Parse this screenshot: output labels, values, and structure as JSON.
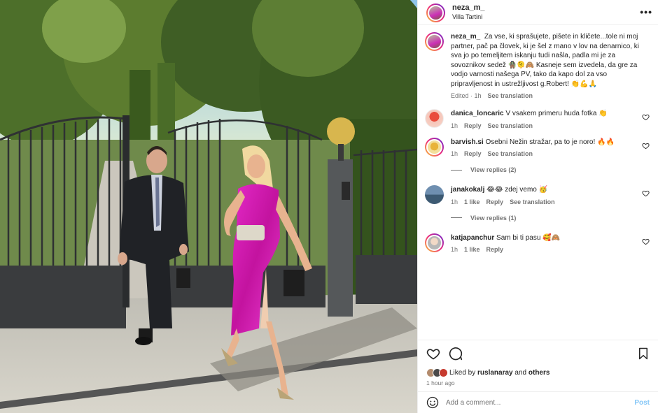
{
  "post": {
    "username": "neza_m_",
    "location": "Villa Tartini",
    "caption_user": "neza_m_",
    "caption_text": "Za vse, ki sprašujete, pišete in kličete...tole ni moj partner, pač pa človek, ki je šel z mano v lov na denarnico, ki sva jo po temeljitem iskanju tudi našla, padla mi je za sovoznikov sedež 🧌🫠🙈 Kasneje sem izvedela, da gre za vodjo varnosti našega PV, tako da kapo dol za vso pripravljenost in ustrežljivost g.Robert! 👏💪🙏",
    "caption_meta": "Edited · 1h",
    "see_translation": "See translation",
    "liked_by_prefix": "Liked by",
    "liked_by_user": "ruslanaray",
    "liked_by_and": "and",
    "liked_by_others": "others",
    "time_ago": "1 hour ago",
    "add_comment_placeholder": "Add a comment...",
    "post_label": "Post",
    "more_label": "•••"
  },
  "comments": [
    {
      "user": "danica_loncaric",
      "text": "V vsakem primeru huda fotka 👏",
      "time": "1h",
      "likes": "",
      "reply": "Reply",
      "translate": "See translation",
      "view_replies": ""
    },
    {
      "user": "barvish.si",
      "text": "Osebni Nežin stražar, pa to je noro! 🔥🔥",
      "time": "1h",
      "likes": "",
      "reply": "Reply",
      "translate": "See translation",
      "view_replies": "View replies (2)"
    },
    {
      "user": "janakokalj",
      "text": "😂😂 zdej vemo 🥳",
      "time": "1h",
      "likes": "1 like",
      "reply": "Reply",
      "translate": "See translation",
      "view_replies": "View replies (1)"
    },
    {
      "user": "katjapanchur",
      "text": "Sam bi ti pasu 🥰🙈",
      "time": "1h",
      "likes": "1 like",
      "reply": "Reply",
      "translate": "",
      "view_replies": ""
    }
  ],
  "icons": {
    "heart": "heart-icon",
    "comment": "comment-icon",
    "save": "bookmark-icon",
    "emoji": "emoji-icon",
    "more": "more-options-icon"
  },
  "colors": {
    "link_blue": "#85c7f7",
    "secondary_text": "#737373",
    "dress_magenta": "#d11bb5"
  }
}
